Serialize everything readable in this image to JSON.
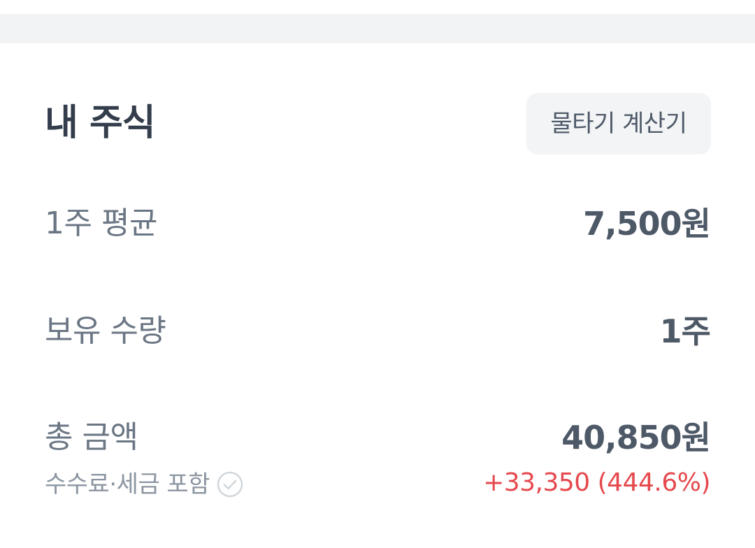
{
  "section": {
    "title": "내 주식",
    "calculator_button_label": "물타기 계산기"
  },
  "rows": {
    "avg_price": {
      "label": "1주 평균",
      "value": "7,500원"
    },
    "quantity": {
      "label": "보유 수량",
      "value": "1주"
    },
    "total": {
      "label": "총 금액",
      "value": "40,850원"
    }
  },
  "fee_note": {
    "text": "수수료·세금 포함",
    "icon": "check-circle-icon"
  },
  "profit": {
    "text": "+33,350 (444.6%)"
  },
  "colors": {
    "profit_red": "#e5484d",
    "title": "#333d4b",
    "label_gray": "#6b7684",
    "button_bg": "#f2f4f6",
    "band_bg": "#f2f3f5"
  }
}
